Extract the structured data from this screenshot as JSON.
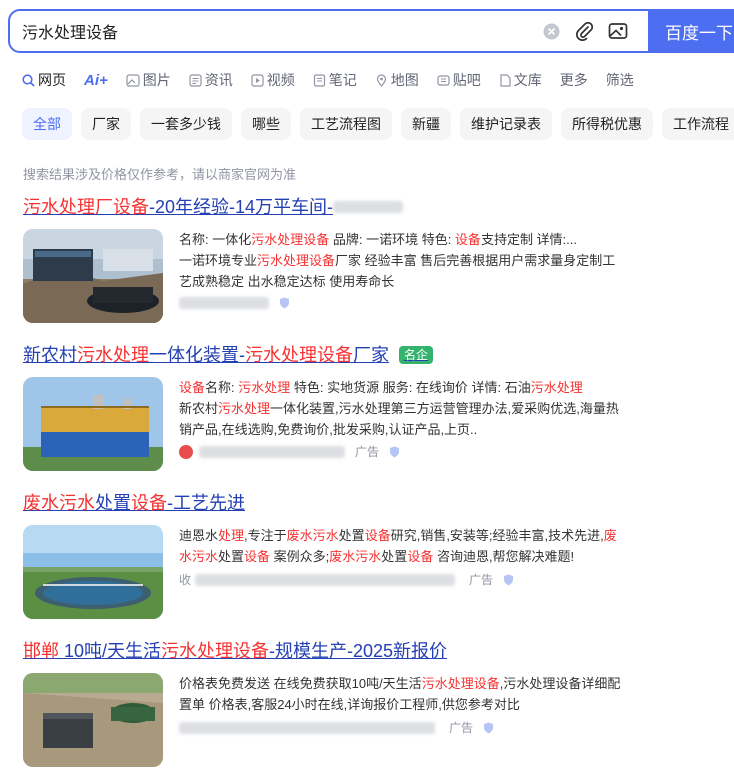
{
  "search": {
    "query": "污水处理设备",
    "button": "百度一下"
  },
  "tabs": [
    {
      "label": "网页",
      "icon": "search-icon"
    },
    {
      "label": "Ai+",
      "icon": ""
    },
    {
      "label": "图片",
      "icon": "image-icon"
    },
    {
      "label": "资讯",
      "icon": "news-icon"
    },
    {
      "label": "视频",
      "icon": "video-icon"
    },
    {
      "label": "笔记",
      "icon": "note-icon"
    },
    {
      "label": "地图",
      "icon": "map-icon"
    },
    {
      "label": "贴吧",
      "icon": "tieba-icon"
    },
    {
      "label": "文库",
      "icon": "doc-icon"
    },
    {
      "label": "更多",
      "icon": ""
    },
    {
      "label": "筛选",
      "icon": ""
    }
  ],
  "chips": [
    "全部",
    "厂家",
    "一套多少钱",
    "哪些",
    "工艺流程图",
    "新疆",
    "维护记录表",
    "所得税优惠",
    "工作流程"
  ],
  "notice": "搜索结果涉及价格仅作参考，请以商家官网为准",
  "results": [
    {
      "title_parts": [
        {
          "t": "污水处理厂设备",
          "hl": true
        },
        {
          "t": "-20年经验-14万平车间-",
          "hl": false
        }
      ],
      "line1": [
        {
          "t": "名称: 一体化",
          "hl": false
        },
        {
          "t": "污水处理设备",
          "hl": true
        },
        {
          "t": "    品牌: 一诺环境    特色: ",
          "hl": false
        },
        {
          "t": "设备",
          "hl": true
        },
        {
          "t": "支持定制    详情:...",
          "hl": false
        }
      ],
      "line2": [
        {
          "t": "一诺环境专业",
          "hl": false
        },
        {
          "t": "污水处理设备",
          "hl": true
        },
        {
          "t": "厂家 经验丰富 售后完善根据用户需求量身定制工艺成熟稳定 出水稳定达标 使用寿命长",
          "hl": false
        }
      ],
      "meta_ad": ""
    },
    {
      "title_parts": [
        {
          "t": "新农村",
          "hl": false
        },
        {
          "t": "污水处理",
          "hl": true
        },
        {
          "t": "一体化装置-",
          "hl": false
        },
        {
          "t": "污水处理设备",
          "hl": true
        },
        {
          "t": "厂家",
          "hl": false
        }
      ],
      "badge": "名企",
      "line1": [
        {
          "t": "设备",
          "hl": true
        },
        {
          "t": "名称: ",
          "hl": false
        },
        {
          "t": "污水处理",
          "hl": true
        },
        {
          "t": "    特色: 实地货源    服务: 在线询价    详情: 石油",
          "hl": false
        },
        {
          "t": "污水处理",
          "hl": true
        }
      ],
      "line2": [
        {
          "t": "新农村",
          "hl": false
        },
        {
          "t": "污水处理",
          "hl": true
        },
        {
          "t": "一体化装置,污水处理第三方运营管理办法,爱采购优选,海量热销产品,在线选购,免费询价,批发采购,认证产品,上页..",
          "hl": false
        }
      ],
      "meta_ad": "广告"
    },
    {
      "title_parts": [
        {
          "t": "废水",
          "hl": true
        },
        {
          "t": "污水",
          "hl": true
        },
        {
          "t": "处置",
          "hl": false
        },
        {
          "t": "设备",
          "hl": true
        },
        {
          "t": "-工艺先进",
          "hl": false
        }
      ],
      "line2": [
        {
          "t": "迪恩水",
          "hl": false
        },
        {
          "t": "处理",
          "hl": true
        },
        {
          "t": ",专注于",
          "hl": false
        },
        {
          "t": "废水污水",
          "hl": true
        },
        {
          "t": "处置",
          "hl": false
        },
        {
          "t": "设备",
          "hl": true
        },
        {
          "t": "研究,销售,安装等;经验丰富,技术先进,",
          "hl": false
        },
        {
          "t": "废水污水",
          "hl": true
        },
        {
          "t": "处置",
          "hl": false
        },
        {
          "t": "设备",
          "hl": true
        },
        {
          "t": " 案例众多;",
          "hl": false
        },
        {
          "t": "废水污水",
          "hl": true
        },
        {
          "t": "处置",
          "hl": false
        },
        {
          "t": "设备",
          "hl": true
        },
        {
          "t": " 咨询迪恩,帮您解决难题!",
          "hl": false
        }
      ],
      "meta_prefix": "收",
      "meta_ad": "广告"
    },
    {
      "title_parts": [
        {
          "t": "邯郸",
          "hl": true
        },
        {
          "t": " 10吨/天生活",
          "hl": false
        },
        {
          "t": "污水处理设备",
          "hl": true
        },
        {
          "t": "-规模生产-2025新报价",
          "hl": false
        }
      ],
      "line2": [
        {
          "t": "价格表免费发送 在线免费获取10吨/天生活",
          "hl": false
        },
        {
          "t": "污水处理设备",
          "hl": true
        },
        {
          "t": ",污水处理设备详细配置单 价格表,客服24小时在线,详询报价工程师,供您参考对比",
          "hl": false
        }
      ],
      "meta_ad": "广告"
    }
  ],
  "colors": {
    "brand": "#4e6ef2",
    "link": "#2440b3",
    "highlight": "#f73131",
    "badge": "#34b36e"
  }
}
